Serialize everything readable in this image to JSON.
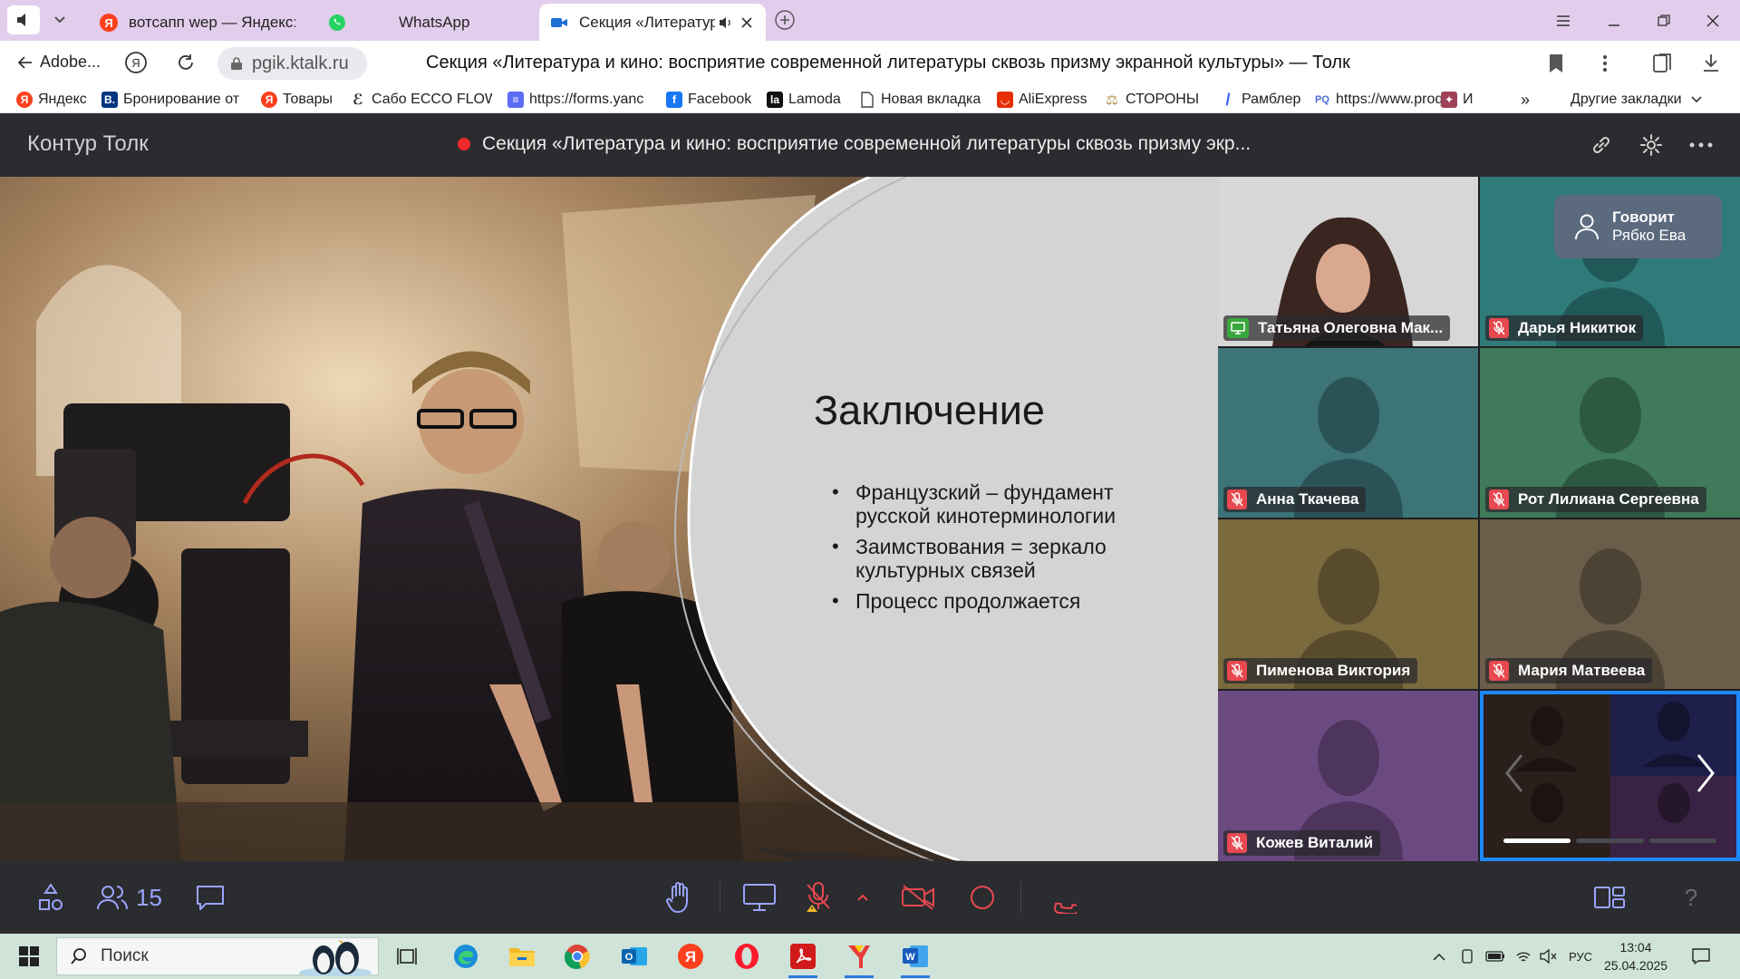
{
  "browser": {
    "tabs": [
      {
        "title": "вотсапп wep — Яндекс: на"
      },
      {
        "title": "WhatsApp"
      },
      {
        "title": "Секция «Литература"
      }
    ],
    "back_label": "Adobe...",
    "url": "pgik.ktalk.ru",
    "page_title": "Секция «Литература и кино: восприятие современной литературы сквозь призму экранной культуры» — Толк",
    "bookmarks": [
      {
        "label": "Яндекс",
        "icon": "yandex-icon",
        "color": "#fc3f1d"
      },
      {
        "label": "Бронирование от",
        "icon": "booking-icon",
        "color": "#003580"
      },
      {
        "label": "Товары",
        "icon": "yandex-market-icon",
        "color": "#fc3f1d"
      },
      {
        "label": "Сабо ECCO FLOW",
        "icon": "ecco-icon",
        "color": "#222222"
      },
      {
        "label": "https://forms.yanc",
        "icon": "forms-icon",
        "color": "#5b6df6"
      },
      {
        "label": "Facebook",
        "icon": "facebook-icon",
        "color": "#1877f2"
      },
      {
        "label": "Lamoda",
        "icon": "lamoda-icon",
        "color": "#111111"
      },
      {
        "label": "Новая вкладка",
        "icon": "page-icon",
        "color": "#666666"
      },
      {
        "label": "AliExpress",
        "icon": "aliexpress-icon",
        "color": "#e62e04"
      },
      {
        "label": "СТОРОНЫ",
        "icon": "scales-icon",
        "color": "#b08a4a"
      },
      {
        "label": "Рамблер",
        "icon": "rambler-icon",
        "color": "#315efb"
      },
      {
        "label": "https://www.proq",
        "icon": "pq-icon",
        "color": "#4a6bd6"
      },
      {
        "label": "И",
        "icon": "bookmark-icon",
        "color": "#a0415a"
      }
    ],
    "other_bookmarks": "Другие закладки",
    "more_bookmarks": "»"
  },
  "app": {
    "brand": "Контур Толк",
    "meeting_title": "Секция «Литература и кино: восприятие современной литературы сквозь призму экр...",
    "recording_color": "#ee2a2a"
  },
  "slide": {
    "title": "Заключение",
    "bullets": [
      "Французский – фундамент русской кинотерминологии",
      "Заимствования = зеркало культурных связей",
      "Процесс продолжается"
    ]
  },
  "speaking": {
    "label": "Говорит",
    "name": "Рябко Ева"
  },
  "participants": [
    {
      "name": "Татьяна Олеговна Мак...",
      "status": "screen-share",
      "bg": "#cfcfcf"
    },
    {
      "name": "Дарья Никитюк",
      "status": "muted",
      "bg": "#2f7b7a"
    },
    {
      "name": "Анна Ткачева",
      "status": "muted",
      "bg": "#3c7478"
    },
    {
      "name": "Рот Лилиана Сергеевна",
      "status": "muted",
      "bg": "#3f7a5a"
    },
    {
      "name": "Пименова Виктория",
      "status": "muted",
      "bg": "#7a6a3e"
    },
    {
      "name": "Мария Матвеева",
      "status": "muted",
      "bg": "#6b5d4a"
    },
    {
      "name": "Кожев Виталий",
      "status": "muted",
      "bg": "#6b4a82"
    }
  ],
  "pager": {
    "pages": 3,
    "current": 1
  },
  "toolbar": {
    "participants_count": "15",
    "help": "?"
  },
  "taskbar": {
    "search_placeholder": "Поиск",
    "language": "РУС",
    "time": "13:04",
    "date": "25.04.2025"
  }
}
